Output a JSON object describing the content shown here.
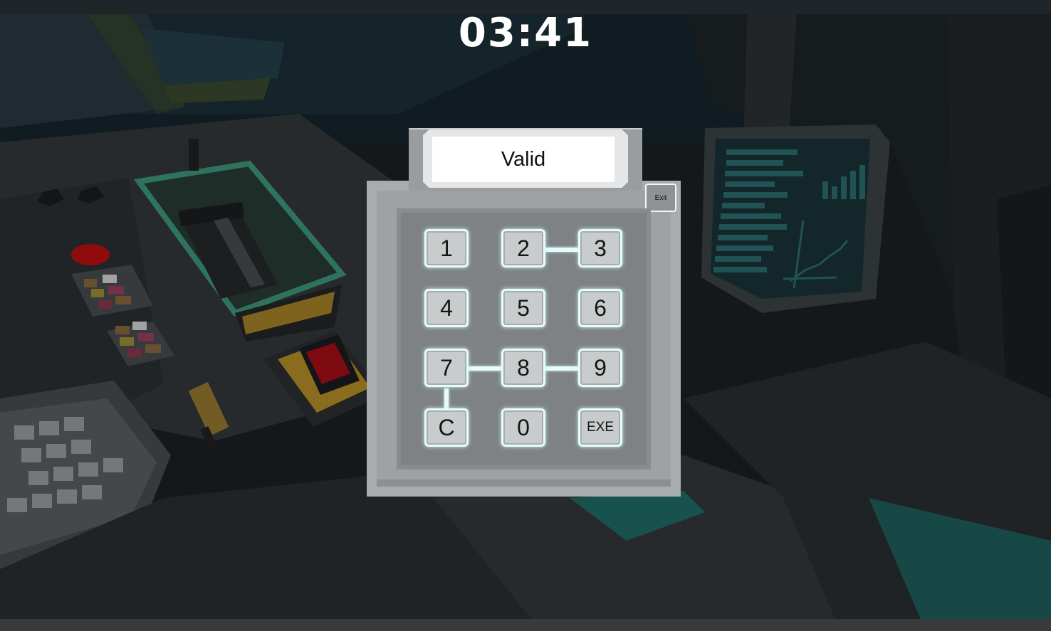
{
  "hud": {
    "timer": "03:41"
  },
  "keypad": {
    "display_text": "Valid",
    "exit_label": "Exit",
    "keys": [
      {
        "label": "1"
      },
      {
        "label": "2"
      },
      {
        "label": "3"
      },
      {
        "label": "4"
      },
      {
        "label": "5"
      },
      {
        "label": "6"
      },
      {
        "label": "7"
      },
      {
        "label": "8"
      },
      {
        "label": "9"
      },
      {
        "label": "C"
      },
      {
        "label": "0"
      },
      {
        "label": "EXE"
      }
    ]
  },
  "colors": {
    "key_glow": "#e8fbfb",
    "console_teal": "#1f6e69",
    "alarm_red": "#c01010"
  }
}
